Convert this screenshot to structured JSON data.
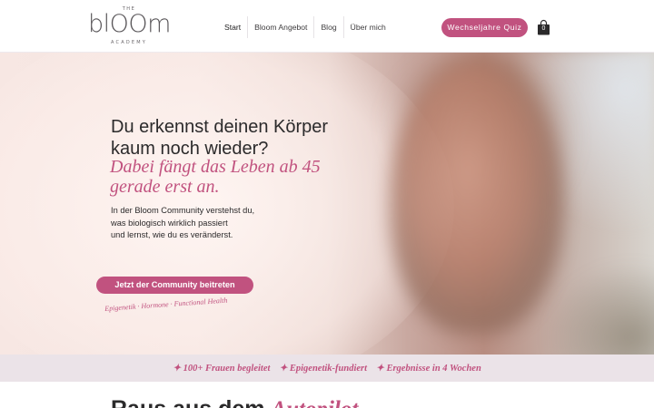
{
  "header": {
    "logo": {
      "top": "THE",
      "main": "blOOm",
      "sub": "ACADEMY"
    },
    "nav": [
      {
        "label": "Start"
      },
      {
        "label": "Bloom Angebot"
      },
      {
        "label": "Blog"
      },
      {
        "label": "Über mich"
      }
    ],
    "quiz_label": "Wechseljahre Quiz",
    "cart_count": "0"
  },
  "hero": {
    "heading_line1": "Du erkennst deinen Körper",
    "heading_line2": "kaum noch wieder?",
    "highlight_line1": "Dabei fängt das Leben ab 45",
    "highlight_line2": "gerade erst an.",
    "text_line1": "In der Bloom Community verstehst du,",
    "text_line2": "was biologisch wirklich passiert",
    "text_line3": "und lernst, wie du es veränderst.",
    "cta_label": "Jetzt der Community beitreten",
    "tagline": "Epigenetik · Hormone · Functional Health"
  },
  "band": {
    "items": [
      "✦ 100+ Frauen begleitet",
      "✦ Epigenetik-fundiert",
      "✦ Ergebnisse in 4 Wochen"
    ]
  },
  "next_section": {
    "title_part1": "Raus aus dem ",
    "title_accent": "Autopilot"
  },
  "colors": {
    "accent": "#c1527f",
    "band_bg": "#ebe3e8",
    "text": "#2b2a2b"
  },
  "icons": {
    "cart": "shopping-bag-icon"
  }
}
